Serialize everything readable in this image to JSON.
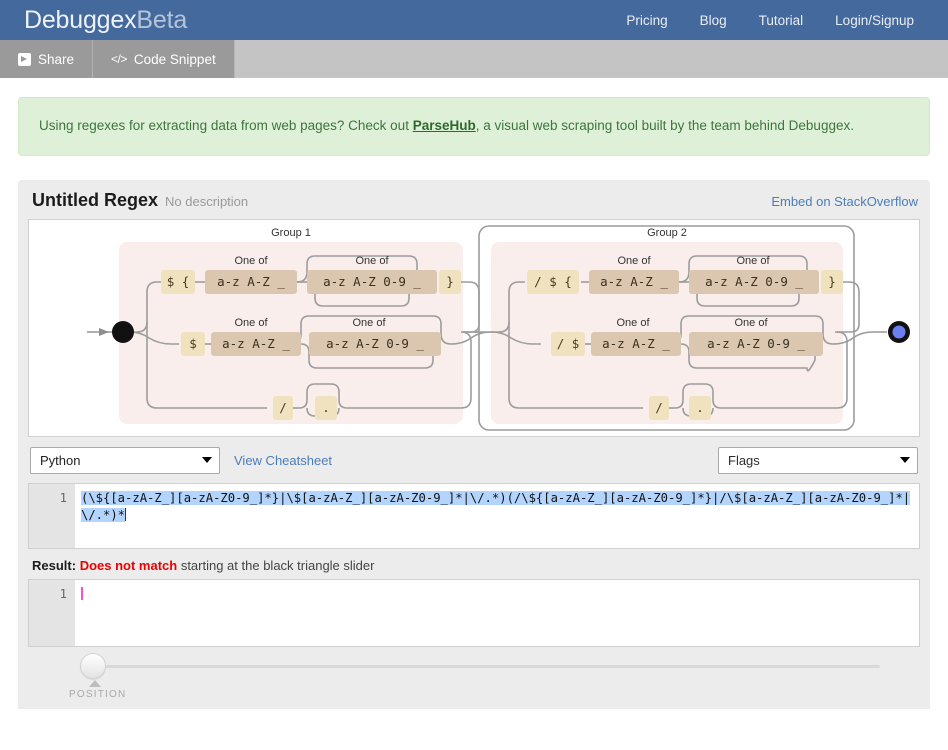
{
  "navbar": {
    "brand_main": "Debuggex",
    "brand_beta": "Beta",
    "links": [
      {
        "label": "Pricing"
      },
      {
        "label": "Blog"
      },
      {
        "label": "Tutorial"
      },
      {
        "label": "Login/Signup"
      }
    ]
  },
  "toolbar": {
    "share_label": "Share",
    "code_snippet_label": "Code Snippet",
    "code_icon": "</>"
  },
  "notice": {
    "before": "Using regexes for extracting data from web pages? Check out ",
    "link": "ParseHub",
    "after": ", a visual web scraping tool built by the team behind Debuggex."
  },
  "panel": {
    "title": "Untitled Regex",
    "description": "No description",
    "embed_link": "Embed on StackOverflow"
  },
  "diagram": {
    "group1_label": "Group 1",
    "group2_label": "Group 2",
    "one_of_label": "One of",
    "g1_row1_literal": "$ {",
    "g1_row1_class1": "a-z A-Z _",
    "g1_row1_class2": "a-z A-Z 0-9 _",
    "g1_row1_close": "}",
    "g1_row2_literal": "$",
    "g1_row2_class1": "a-z A-Z _",
    "g1_row2_class2": "a-z A-Z 0-9 _",
    "g1_row3_literal": "/",
    "g1_row3_dot": ".",
    "g2_row1_literal": "/ $ {",
    "g2_row1_class1": "a-z A-Z _",
    "g2_row1_class2": "a-z A-Z 0-9 _",
    "g2_row1_close": "}",
    "g2_row2_literal": "/ $",
    "g2_row2_class1": "a-z A-Z _",
    "g2_row2_class2": "a-z A-Z 0-9 _",
    "g2_row3_literal": "/",
    "g2_row3_dot": "."
  },
  "controls": {
    "flavor_value": "Python",
    "cheatsheet_label": "View Cheatsheet",
    "flags_value": "Flags"
  },
  "regex_editor": {
    "line_number": "1",
    "value": "(\\${[a-zA-Z_][a-zA-Z0-9_]*}|\\$[a-zA-Z_][a-zA-Z0-9_]*|\\/.*)(/\\${[a-zA-Z_][a-zA-Z0-9_]*}|/\\$[a-zA-Z_][a-zA-Z0-9_]*|\\/.*)*"
  },
  "result": {
    "label": "Result:",
    "status": "Does not match",
    "tail": " starting at the black triangle slider",
    "line_number": "1",
    "value": ""
  },
  "slider": {
    "label": "POSITION"
  },
  "colors": {
    "navbar": "#44699d",
    "toolbar": "#c4c4c4",
    "notice_bg": "#dff0d8",
    "notice_text": "#3c763d",
    "panel_bg": "#ececec",
    "link": "#4a7ebb",
    "error": "#ee0000",
    "group_bg": "#f9eeec",
    "literal_box": "#f0e2bf",
    "class_box": "#dbc7b0",
    "end_node": "#6b7ff0"
  }
}
